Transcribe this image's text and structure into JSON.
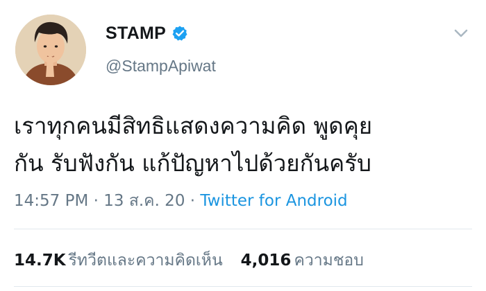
{
  "user": {
    "display_name": "STAMP",
    "handle": "@StampApiwat",
    "verified": true
  },
  "tweet": {
    "text_lines": [
      "เราทุกคนมีสิทธิแสดงความคิด พูดคุย",
      "กัน รับฟังกัน แก้ปัญหาไปด้วยกันครับ"
    ],
    "time": "14:57 PM",
    "separator": " · ",
    "date": "13 ส.ค. 20",
    "source": "Twitter for Android"
  },
  "stats": {
    "retweets_count": "14.7K",
    "retweets_label": "รีทวีตและความคิดเห็น",
    "likes_count": "4,016",
    "likes_label": "ความชอบ"
  },
  "icons": {
    "verified": "verified-badge-icon",
    "menu": "chevron-down-icon"
  },
  "colors": {
    "verified_blue": "#1da1f2",
    "link_blue": "#1b95e0",
    "secondary_text": "#657786",
    "primary_text": "#14171a"
  }
}
